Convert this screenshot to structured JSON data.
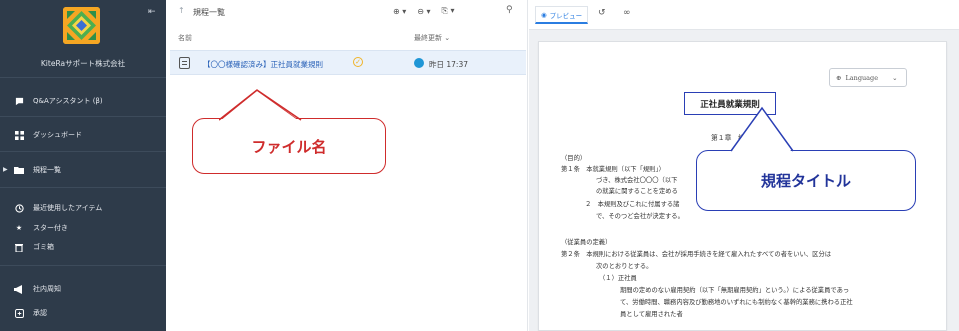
{
  "sidebar": {
    "collapse_icon": "collapse-left-icon",
    "company": "KiteRaサポート株式会社",
    "items": [
      {
        "icon": "chat-bubble-icon",
        "label": "Q&Aアシスタント (β)"
      },
      {
        "icon": "dashboard-icon",
        "label": "ダッシュボード"
      },
      {
        "icon": "folder-icon",
        "label": "規程一覧"
      },
      {
        "icon": "clock-icon",
        "label": "最近使用したアイテム"
      },
      {
        "icon": "star-icon",
        "label": "スター付き"
      },
      {
        "icon": "trash-icon",
        "label": "ゴミ箱"
      },
      {
        "icon": "megaphone-icon",
        "label": "社内周知"
      },
      {
        "icon": "approval-icon",
        "label": "承認"
      }
    ]
  },
  "list": {
    "title": "規程一覧",
    "col_name": "名前",
    "col_updated": "最終更新",
    "rows": [
      {
        "name": "【〇〇様確認済み】正社員就業規則",
        "updated": "昨日 17:37"
      }
    ]
  },
  "callouts": {
    "file_name": "ファイル名",
    "rule_title": "規程タイトル"
  },
  "preview": {
    "tab_label": "プレビュー",
    "language": "Language",
    "doc_title": "正社員就業規則",
    "chapter": "第１章　総",
    "lines": [
      "（目的）",
      "第１条　本就業規則（以下「規則」）",
      "づき、株式会社〇〇〇（以下",
      "の就業に関することを定める",
      "２　本規則及びこれに付属する諸",
      "で、そのつど会社が決定する。",
      "（従業員の定義）",
      "第２条　本規則における従業員は、会社が採用手続きを経て雇入れたすべての者をいい、区分は",
      "次のとおりとする。",
      "（１）正社員",
      "期間の定めのない雇用契約（以下「無期雇用契約」という。）による従業員であっ",
      "て、労働時間、職務内容及び勤務地のいずれにも制約なく基幹的業務に携わる正社",
      "員として雇用された者"
    ]
  },
  "colors": {
    "sidebar_bg": "#2e3b4a",
    "accent_blue": "#2a7de1",
    "callout_red": "#cf2c2c",
    "callout_blue": "#2a3fb5",
    "logo_orange": "#f5a623"
  }
}
